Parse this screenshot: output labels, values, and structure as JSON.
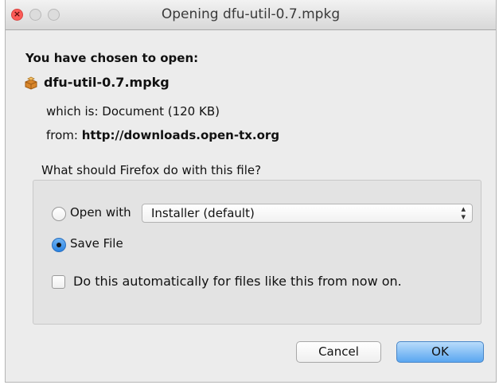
{
  "window": {
    "title": "Opening dfu-util-0.7.mpkg",
    "close_glyph": "×"
  },
  "dialog": {
    "heading": "You have chosen to open:",
    "file_icon": "package-icon",
    "file_name": "dfu-util-0.7.mpkg",
    "which_is": "which is: Document (120 KB)",
    "from_label": "from: ",
    "from_url": "http://downloads.open-tx.org",
    "question": "What should Firefox do with this file?"
  },
  "options": {
    "open_with_label": "Open with",
    "open_with_selected": false,
    "app_select_value": "Installer (default)",
    "save_file_label": "Save File",
    "save_file_selected": true,
    "auto_label": "Do this automatically for files like this from now on.",
    "auto_checked": false
  },
  "buttons": {
    "cancel": "Cancel",
    "ok": "OK"
  },
  "colors": {
    "accent": "#2a84e3",
    "close_light": "#fc5b57"
  }
}
